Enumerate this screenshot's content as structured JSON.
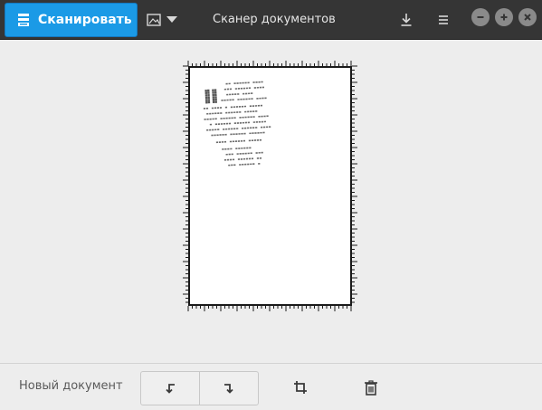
{
  "header": {
    "scan_button_label": "Сканировать",
    "title": "Сканер документов",
    "icons": {
      "scan": "scanner-icon",
      "image_menu": "image-icon",
      "dropdown": "chevron-down-icon",
      "save": "download-icon",
      "menu": "hamburger-menu-icon",
      "minimize": "minimize-icon",
      "maximize": "maximize-icon",
      "close": "close-icon"
    }
  },
  "footer": {
    "new_document_label": "Новый документ",
    "icons": {
      "rotate_left": "rotate-left-icon",
      "rotate_right": "rotate-right-icon",
      "crop": "crop-icon",
      "delete": "trash-icon"
    }
  },
  "colors": {
    "accent": "#1b9ae6",
    "headerbar": "#353535",
    "background": "#ededed"
  }
}
